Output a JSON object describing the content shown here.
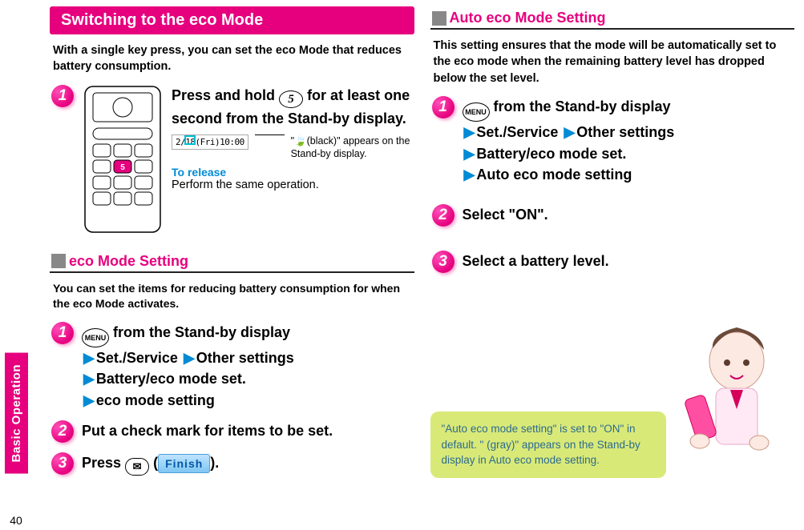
{
  "side_tab": {
    "label": "Basic Operation"
  },
  "page_number": "40",
  "left": {
    "title": "Switching to the eco Mode",
    "intro": "With a single key press, you can set the eco Mode that reduces battery consumption.",
    "step1": {
      "num": "1",
      "instr_a": "Press and hold ",
      "key5": "5",
      "instr_b": " for at least one second from the Stand-by display.",
      "screen_text": "2/18(Fri)10:00",
      "note_black_appears": "(black)\" appears on the Stand-by display.",
      "note_black_appears_prefix": "\"",
      "release_head": "To release",
      "release_text": "Perform the same operation."
    },
    "section_eco": {
      "heading": "eco Mode Setting",
      "desc": "You can set the items for reducing battery consumption for when the eco Mode activates."
    },
    "eco_step1": {
      "num": "1",
      "menu_label": "MENU",
      "l1": " from the Stand-by display",
      "l2a": "Set./Service",
      "l2b": "Other settings",
      "l3": "Battery/eco mode set.",
      "l4": "eco mode setting"
    },
    "eco_step2": {
      "num": "2",
      "text": "Put a check mark for items to be set."
    },
    "eco_step3": {
      "num": "3",
      "text_a": "Press ",
      "mail_icon": "✉",
      "text_b": "(",
      "finish": "Finish",
      "text_c": ")."
    }
  },
  "right": {
    "section_auto": {
      "heading": "Auto eco Mode Setting"
    },
    "intro": "This setting ensures that the mode will be automatically set to the eco mode when the remaining battery level has dropped below the set level.",
    "auto_step1": {
      "num": "1",
      "menu_label": "MENU",
      "l1": " from the Stand-by display",
      "l2a": "Set./Service",
      "l2b": "Other settings",
      "l3": "Battery/eco mode set.",
      "l4": "Auto eco mode setting"
    },
    "auto_step2": {
      "num": "2",
      "text": "Select \"ON\"."
    },
    "auto_step3": {
      "num": "3",
      "text": "Select a battery level."
    },
    "callout": "\"Auto eco mode setting\" is set to \"ON\" in default. \"   (gray)\" appears on the Stand-by display in Auto eco mode setting."
  },
  "icons": {
    "leaf": "🍃"
  }
}
